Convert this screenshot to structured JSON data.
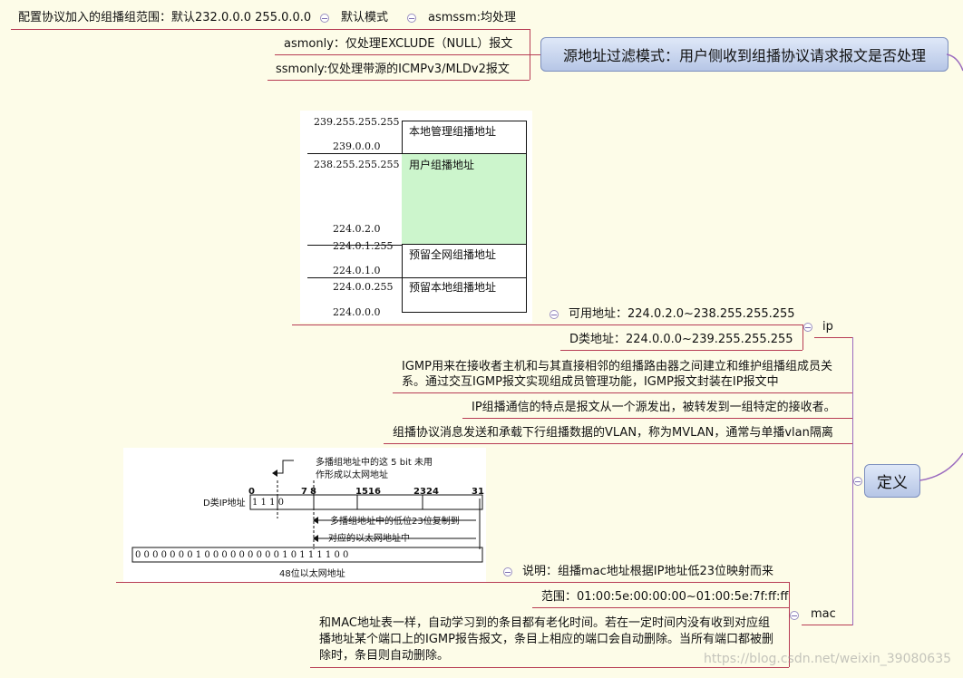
{
  "top": {
    "range_text": "配置协议加入的组播组范围：默认232.0.0.0 255.0.0.0",
    "default_mode": "默认模式",
    "asmssm": "asmssm:均处理",
    "asmonly": "asmonly：仅处理EXCLUDE（NULL）报文",
    "ssmonly": "ssmonly:仅处理带源的ICMPv3/MLDv2报文",
    "topic": "源地址过滤模式：用户侧收到组播协议请求报文是否处理"
  },
  "addr_table": {
    "labels": [
      "239.255.255.255",
      "239.0.0.0",
      "238.255.255.255",
      "224.0.2.0",
      "224.0.1.255",
      "224.0.1.0",
      "224.0.0.255",
      "224.0.0.0"
    ],
    "segments": [
      "本地管理组播地址",
      "用户组播地址",
      "预留全网组播地址",
      "预留本地组播地址"
    ]
  },
  "ip": {
    "label": "ip",
    "usable": "可用地址：224.0.2.0~238.255.255.255",
    "class_d": "D类地址：224.0.0.0~239.255.255.255"
  },
  "definition": {
    "label": "定义",
    "igmp_line1": "IGMP用来在接收者主机和与其直接相邻的组播路由器之间建立和维护组播组成员关",
    "igmp_line2": "系。通过交互IGMP报文实现组成员管理功能，IGMP报文封装在IP报文中",
    "feature": "IP组播通信的特点是报文从一个源发出，被转发到一组特定的接收者。",
    "mvlan": "组播协议消息发送和承载下行组播数据的VLAN，称为MVLAN，通常与单播vlan隔离"
  },
  "mac_diagram": {
    "note1": "多播组地址中的这 5 bit 未用",
    "note2": "作形成以太网地址",
    "bit_labels": [
      "0",
      "7",
      "8",
      "15",
      "16",
      "23",
      "24",
      "31"
    ],
    "ip_label": "D类IP地址",
    "ip_bits": "1 1 1 0",
    "copy_note1": "多播组地址中的低位23位复制到",
    "copy_note2": "对应的以太网地址中",
    "mac_bits": "0 0 0 0 0 0 0 1 0 0 0 0 0 0 0 0 0 1 0 1 1 1 1 0 0",
    "caption": "48位以太网地址"
  },
  "mac": {
    "label": "mac",
    "explain": "说明：组播mac地址根据IP地址低23位映射而来",
    "range": "范围：01:00:5e:00:00:00~01:00:5e:7f:ff:ff",
    "aging1": "和MAC地址表一样，自动学习到的条目都有老化时间。若在一定时间内没有收到对应组",
    "aging2": "播地址某个端口上的IGMP报告报文，条目上相应的端口会自动删除。当所有端口都被删",
    "aging3": "除时，条目则自动删除。"
  },
  "watermark": "https://blog.csdn.net/weixin_39080635",
  "colors": {
    "branch": "#b73c54",
    "ip_branch": "#9b6bbf",
    "user_segment": "#ccf5cc",
    "topic_fill": "#c9d6ef"
  }
}
